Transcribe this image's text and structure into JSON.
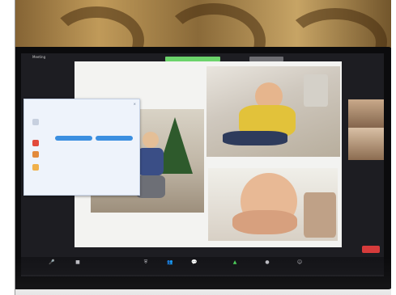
{
  "app": {
    "title": "Zoom Meeting",
    "top_menu": "Meeting",
    "top_green_label": "",
    "top_grey_label": ""
  },
  "dialog": {
    "title": "",
    "close": "×",
    "rows": [
      {
        "label": "",
        "meta": "",
        "color": "#e24a3b"
      },
      {
        "label": "",
        "meta": "",
        "color": "#e28a3b"
      },
      {
        "label": "",
        "meta": "",
        "color": "#f0b04a"
      },
      {
        "label": "",
        "meta": "",
        "color": "#cfcfd4"
      }
    ],
    "pill_left": "",
    "pill_right": "",
    "footer_left": "",
    "footer_right": ""
  },
  "sidebar": {
    "labels": [
      "",
      "",
      ""
    ]
  },
  "toolbar": {
    "items": [
      {
        "icon": "microphone-icon",
        "glyph": "🎤",
        "label": ""
      },
      {
        "icon": "camera-icon",
        "glyph": "■",
        "label": ""
      },
      {
        "icon": "security-icon",
        "glyph": "⛨",
        "label": ""
      },
      {
        "icon": "participants-icon",
        "glyph": "👥",
        "label": ""
      },
      {
        "icon": "chat-icon",
        "glyph": "💬",
        "label": ""
      },
      {
        "icon": "share-screen-icon",
        "glyph": "▲",
        "label": ""
      },
      {
        "icon": "record-icon",
        "glyph": "●",
        "label": ""
      },
      {
        "icon": "reactions-icon",
        "glyph": "☺",
        "label": ""
      }
    ],
    "end_label": ""
  },
  "colors": {
    "accent_green": "#6bd36b",
    "end_red": "#d63b3b",
    "pill_blue": "#3b8fe0"
  }
}
